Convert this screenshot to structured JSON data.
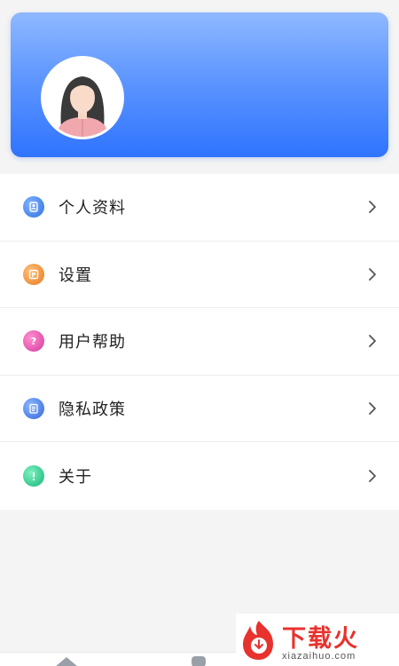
{
  "profile": {
    "avatar_icon": "user-avatar-female"
  },
  "menu": {
    "items": [
      {
        "label": "个人资料",
        "icon": "profile-icon",
        "color": "#3f8cf0"
      },
      {
        "label": "设置",
        "icon": "settings-icon",
        "color": "#f28a2c"
      },
      {
        "label": "用户帮助",
        "icon": "help-icon",
        "color": "#e84fb0"
      },
      {
        "label": "隐私政策",
        "icon": "privacy-icon",
        "color": "#3f7ee8"
      },
      {
        "label": "关于",
        "icon": "info-icon",
        "color": "#22c88a"
      }
    ]
  },
  "watermark": {
    "text": "下载火",
    "url": "xiazaihuo.com",
    "color": "#e8322e"
  },
  "colors": {
    "header_gradient_top": "#8fb8ff",
    "header_gradient_bottom": "#2f73ff",
    "background": "#f4f4f4"
  }
}
